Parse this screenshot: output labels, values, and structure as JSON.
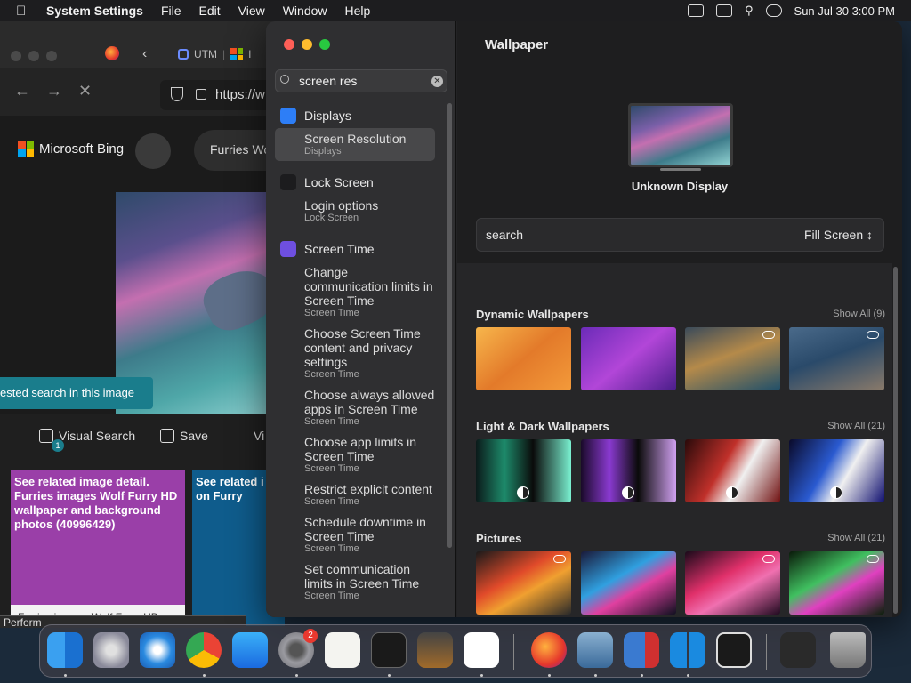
{
  "menubar": {
    "app_name": "System Settings",
    "items": [
      "File",
      "Edit",
      "View",
      "Window",
      "Help"
    ],
    "datetime": "Sun Jul 30  3:00 PM"
  },
  "browser": {
    "tab_utm": "UTM",
    "tab_ms": "I",
    "url": "https://w",
    "bing_name": "Microsoft Bing",
    "search_text": "Furries Wo",
    "tooltip": "ested search in this image",
    "badge_count": "1",
    "visual_search": "Visual Search",
    "save": "Save",
    "more": "Vi",
    "card1_title": "See related image detail. Furries images Wolf Furry HD wallpaper and background photos (40996429)",
    "card1_caption": "Furries images Wolf Furry HD",
    "card2_title": "See related i on Furry",
    "perf_label": "Perform"
  },
  "settings": {
    "search_value": "screen res",
    "groups": [
      {
        "head": "Displays",
        "icon_color": "#2d7ef7",
        "items": [
          {
            "title": "Screen Resolution",
            "sub": "Displays",
            "selected": true
          }
        ]
      },
      {
        "head": "Lock Screen",
        "icon_color": "#1c1c1e",
        "items": [
          {
            "title": "Login options",
            "sub": "Lock Screen"
          }
        ]
      },
      {
        "head": "Screen Time",
        "icon_color": "#6e4fe0",
        "items": [
          {
            "title": "Change communication limits in Screen Time",
            "sub": "Screen Time"
          },
          {
            "title": "Choose Screen Time content and privacy settings",
            "sub": "Screen Time"
          },
          {
            "title": "Choose always allowed apps in Screen Time",
            "sub": "Screen Time"
          },
          {
            "title": "Choose app limits in Screen Time",
            "sub": "Screen Time"
          },
          {
            "title": "Restrict explicit content",
            "sub": "Screen Time"
          },
          {
            "title": "Schedule downtime in Screen Time",
            "sub": "Screen Time"
          },
          {
            "title": "Set communication limits in Screen Time",
            "sub": "Screen Time"
          }
        ]
      }
    ],
    "pane_title": "Wallpaper",
    "display_name": "Unknown Display",
    "search_label": "search",
    "fill_mode": "Fill Screen",
    "sections": [
      {
        "title": "Dynamic Wallpapers",
        "show_all": "Show All (9)"
      },
      {
        "title": "Light & Dark Wallpapers",
        "show_all": "Show All (21)"
      },
      {
        "title": "Pictures",
        "show_all": "Show All (21)"
      }
    ]
  },
  "dock": {
    "settings_badge": "2",
    "apps": [
      "finder",
      "launchpad",
      "safari",
      "chrome",
      "app-store",
      "system-settings",
      "textedit",
      "terminal",
      "guitar",
      "vscode",
      "firefox",
      "virtualbox",
      "remote-desktop",
      "windows",
      "unity",
      "trash"
    ]
  }
}
